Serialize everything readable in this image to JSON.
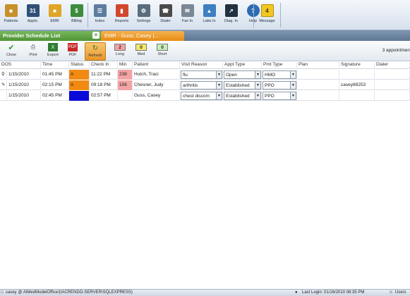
{
  "toolbar": {
    "items": [
      {
        "label": "Patients",
        "icon": "patient-icon",
        "color": "#c8902a"
      },
      {
        "label": "Appts.",
        "icon": "calendar-icon",
        "color": "#2f4f78",
        "glyph": "31"
      },
      {
        "label": "EMR",
        "icon": "folder-icon",
        "color": "#e0a526"
      },
      {
        "label": "Billing",
        "icon": "money-icon",
        "color": "#3c8c3c",
        "glyph": "$"
      },
      {
        "label": "Index",
        "icon": "index-icon",
        "color": "#5d7ca0"
      },
      {
        "label": "Reports",
        "icon": "bar-chart-icon",
        "color": "#d2462d"
      },
      {
        "label": "Settings",
        "icon": "settings-icon",
        "color": "#5b6c7d"
      },
      {
        "label": "Dialer",
        "icon": "dialer-icon",
        "color": "#4a4a4a"
      },
      {
        "label": "Fax In",
        "icon": "fax-icon",
        "color": "#7b8794"
      },
      {
        "label": "Labs In",
        "icon": "labs-icon",
        "color": "#3d7fc1"
      },
      {
        "label": "Diag. In",
        "icon": "diagnostics-icon",
        "color": "#22313f"
      },
      {
        "label": "Help",
        "icon": "help-icon",
        "color": "#2d6bb3",
        "glyph": "?"
      },
      {
        "label": "Message",
        "icon": "message-icon",
        "color": "#f2c61f",
        "glyph": "4"
      }
    ]
  },
  "tabs": {
    "active": "Provider Schedule List",
    "inactive": "EMR - Guss, Casey  |..."
  },
  "subtoolbar": {
    "close": "Close",
    "print": "Print",
    "export": "Export",
    "pdf": "PDF",
    "refresh": "Refresh",
    "long": {
      "label": "Long",
      "count": "2"
    },
    "med": {
      "label": "Med",
      "count": "0"
    },
    "short": {
      "label": "Short",
      "count": "0"
    },
    "appointment_count": "3 appointmen"
  },
  "grid": {
    "columns": [
      "DOS",
      "Time",
      "Status",
      "Check In",
      "Min",
      "Patient",
      "Visit Reason",
      "Appt Type",
      "Pmt Type",
      "Plan",
      "Signature",
      "Dialer"
    ],
    "rows": [
      {
        "dos": "1/15/2010",
        "time": "01:45 PM",
        "status": "A",
        "status_color": "#f28a12",
        "check_in": "11:22 PM",
        "min": "238",
        "patient": "Hutch, Traci",
        "visit_reason": "flu",
        "appt_type": "Open",
        "pmt_type": "HMO",
        "plan": "",
        "signature": "",
        "dialer": ""
      },
      {
        "dos": "1/15/2010",
        "time": "02:15 PM",
        "status": "A",
        "status_color": "#f28a12",
        "check_in": "09:18 PM",
        "min": "106",
        "patient": "Chesner, Judy",
        "visit_reason": "arthritis",
        "appt_type": "Established",
        "pmt_type": "PPO",
        "plan": "",
        "signature": "casey88253",
        "dialer": ""
      },
      {
        "dos": "1/15/2010",
        "time": "02:45 PM",
        "status": "",
        "status_color": "#0a0ad8",
        "check_in": "02:57 PM",
        "min": "",
        "patient": "Guss, Casey",
        "visit_reason": "chest discom",
        "appt_type": "Established",
        "pmt_type": "PPO",
        "plan": "",
        "signature": "",
        "dialer": ""
      }
    ]
  },
  "statusbar": {
    "user": "casey @ AIMedModelOffice/(IACRENDO-SERVER\\SQLEXPRESS)",
    "last_login": "Last Login: 01/16/2010 08:35 PM",
    "users": "Users"
  }
}
